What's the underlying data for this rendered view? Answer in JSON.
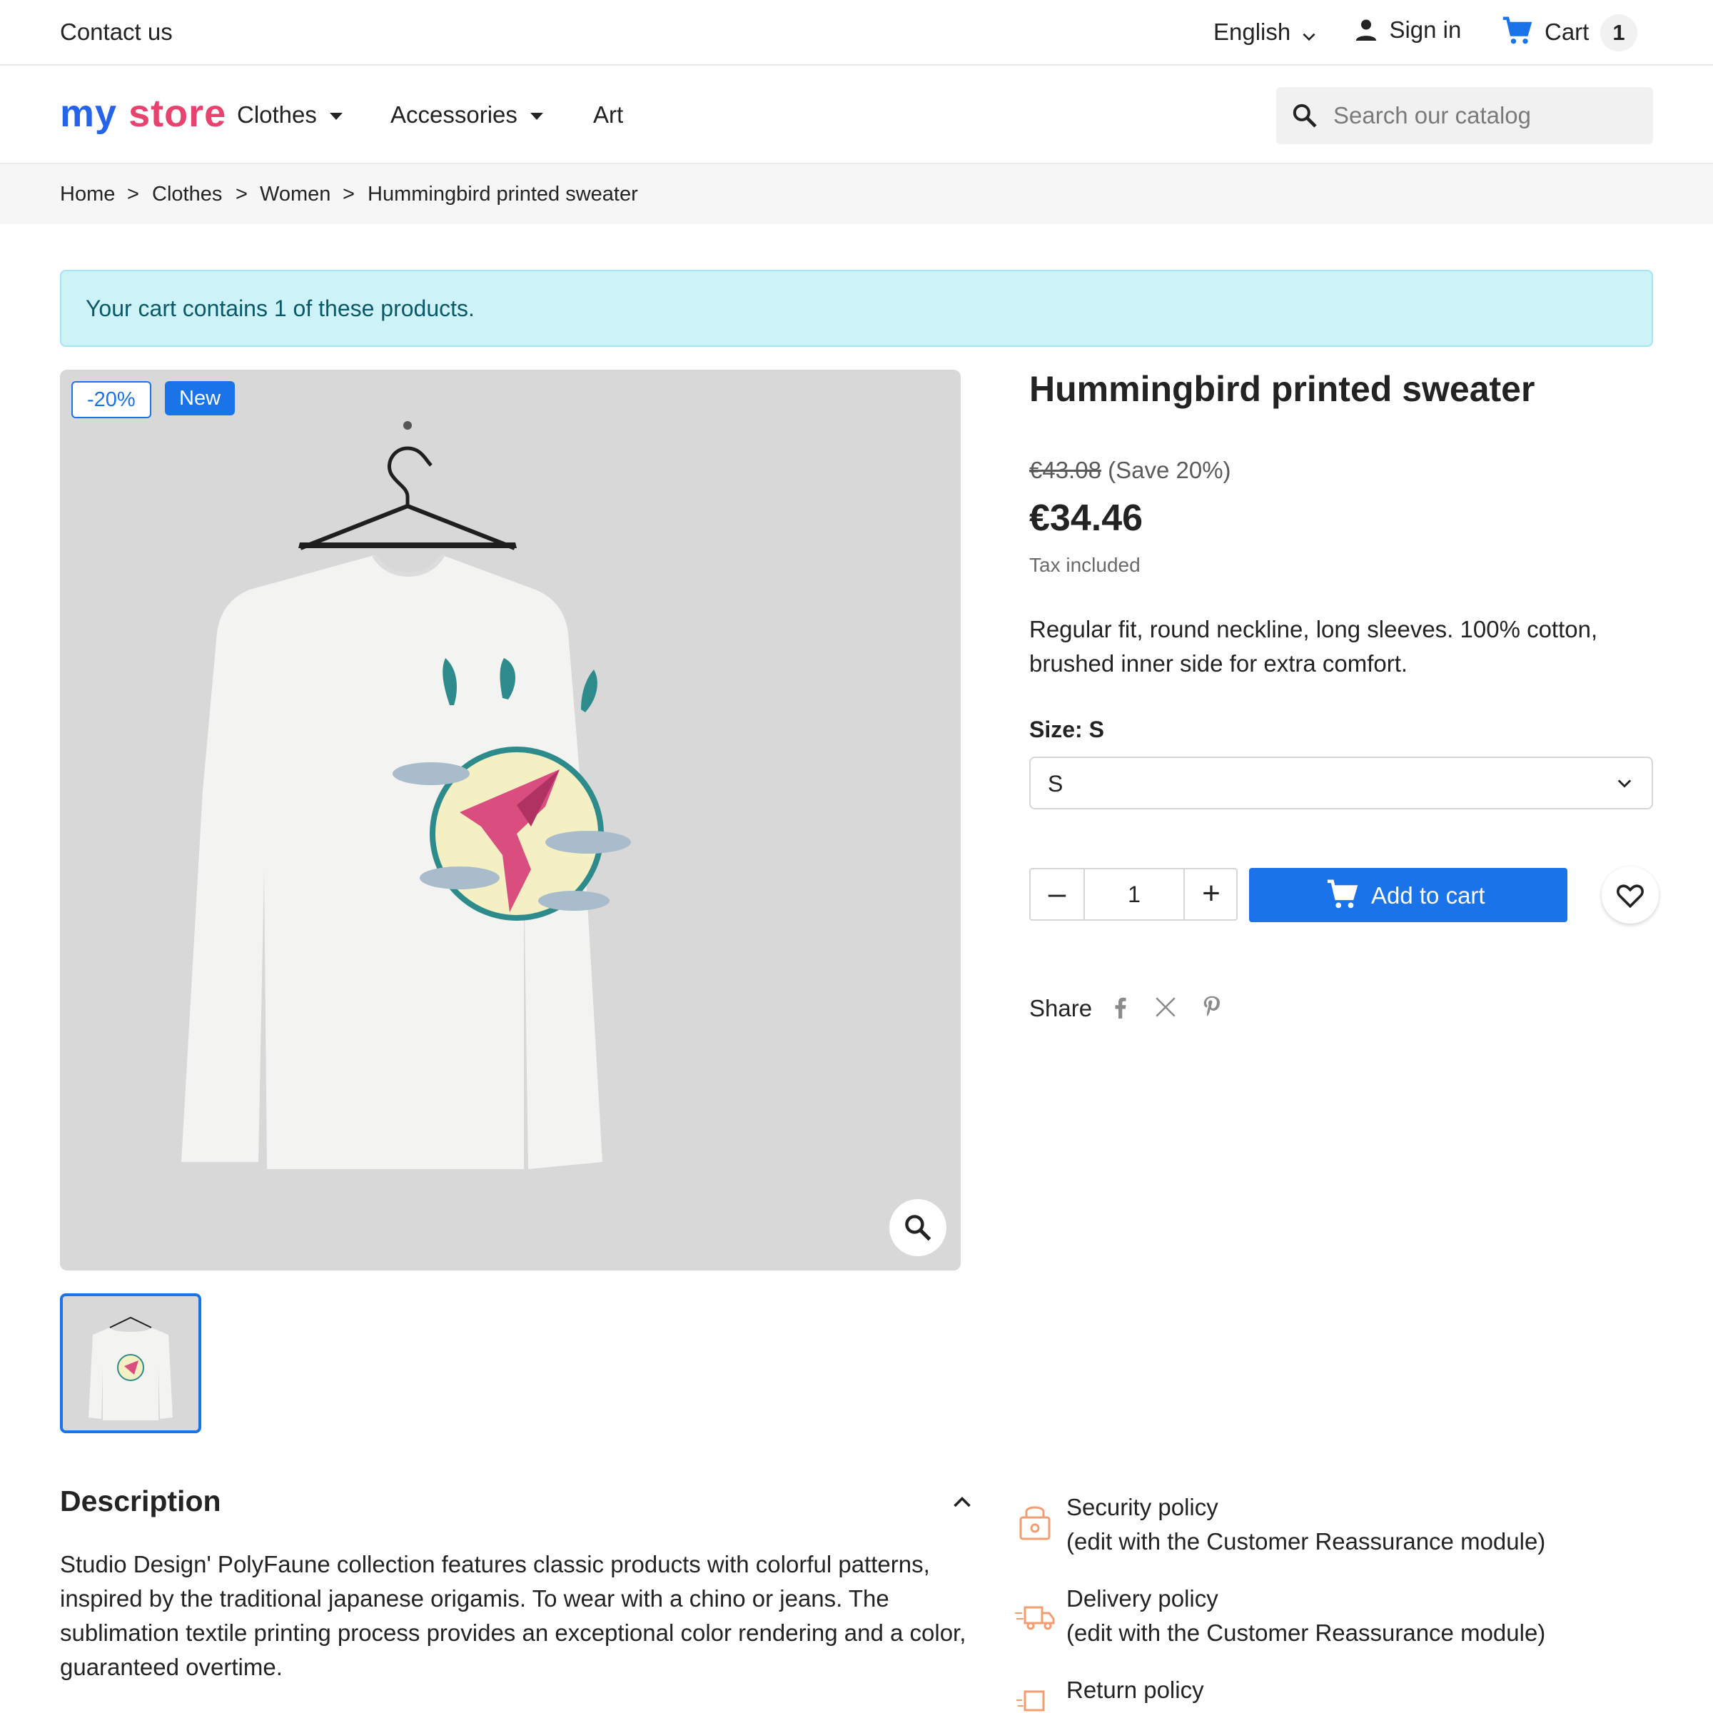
{
  "topbar": {
    "contact": "Contact us",
    "language": "English",
    "signin": "Sign in",
    "cart_label": "Cart",
    "cart_count": "1"
  },
  "header": {
    "logo": {
      "my": "my",
      "store": "store"
    },
    "nav": [
      "Clothes",
      "Accessories",
      "Art"
    ],
    "search_placeholder": "Search our catalog"
  },
  "breadcrumb": {
    "items": [
      "Home",
      "Clothes",
      "Women",
      "Hummingbird printed sweater"
    ],
    "separator": ">"
  },
  "alert": {
    "text": "Your cart contains 1 of these products."
  },
  "product": {
    "badges": {
      "discount": "-20%",
      "new": "New"
    },
    "title": "Hummingbird printed sweater",
    "old_price": "€43.08",
    "save": "(Save 20%)",
    "price": "€34.46",
    "tax": "Tax included",
    "short_description": "Regular fit, round neckline, long sleeves. 100% cotton, brushed inner side for extra comfort.",
    "size_label": "Size: S",
    "size_value": "S",
    "quantity": "1",
    "qty_minus": "–",
    "qty_plus": "+",
    "add_to_cart": "Add to cart",
    "share_label": "Share"
  },
  "description": {
    "title": "Description",
    "body": "Studio Design' PolyFaune collection features classic products with colorful patterns, inspired by the traditional japanese origamis. To wear with a chino or jeans. The sublimation textile printing process provides an exceptional color rendering and a color, guaranteed overtime."
  },
  "reassurance": [
    {
      "title": "Security policy",
      "sub": "(edit with the Customer Reassurance module)"
    },
    {
      "title": "Delivery policy",
      "sub": "(edit with the Customer Reassurance module)"
    },
    {
      "title": "Return policy"
    }
  ],
  "colors": {
    "accent": "#1a73e8",
    "alert_bg": "#cdf3f9",
    "reassurance_icon": "#f39d72"
  },
  "icons": [
    "chevron-down-icon",
    "user-icon",
    "cart-icon",
    "search-icon",
    "zoom-icon",
    "heart-icon",
    "facebook-icon",
    "x-icon",
    "pinterest-icon",
    "lock-icon",
    "truck-icon",
    "return-icon",
    "chevron-up-icon"
  ]
}
